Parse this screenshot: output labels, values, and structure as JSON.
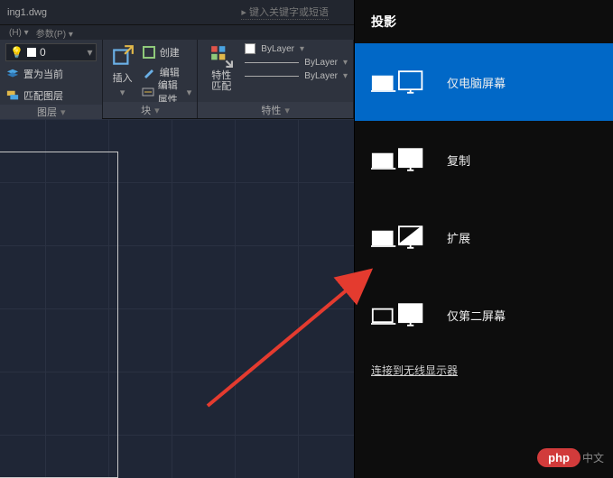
{
  "cad": {
    "doc_title": "ing1.dwg",
    "search_hint": "键入关键字或短语",
    "tabs": {
      "t1": "(H)",
      "t2": "参数(P)"
    },
    "layer_combo_value": "0",
    "layerPanel": {
      "set_current": "置为当前",
      "match_layer": "匹配图层",
      "footer": "图层"
    },
    "blockPanel": {
      "insert": "插入",
      "create": "创建",
      "edit": "编辑",
      "edit_attr": "编辑属性",
      "footer": "块"
    },
    "propPanel": {
      "match": "特性\n匹配",
      "bylayer1": "ByLayer",
      "bylayer2": "ByLayer",
      "bylayer3": "ByLayer",
      "footer": "特性"
    }
  },
  "actionCenter": {
    "title": "投影",
    "options": {
      "pc_only": "仅电脑屏幕",
      "duplicate": "复制",
      "extend": "扩展",
      "second_only": "仅第二屏幕"
    },
    "wireless_link": "连接到无线显示器"
  },
  "watermark": {
    "brand": "php",
    "suffix": "中文"
  }
}
